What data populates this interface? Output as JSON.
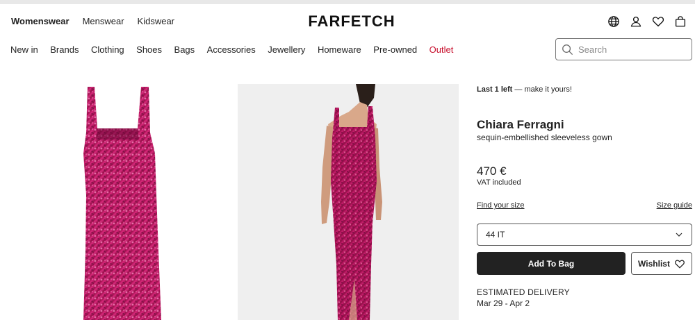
{
  "header": {
    "gender_nav": [
      "Womenswear",
      "Menswear",
      "Kidswear"
    ],
    "active_gender": "Womenswear",
    "logo": "FARFETCH",
    "icons": [
      "globe-icon",
      "account-icon",
      "wishlist-heart-icon",
      "shopping-bag-icon"
    ]
  },
  "categories": [
    "New in",
    "Brands",
    "Clothing",
    "Shoes",
    "Bags",
    "Accessories",
    "Jewellery",
    "Homeware",
    "Pre-owned",
    "Outlet"
  ],
  "colors": {
    "outlet": "#c8102e",
    "primary_button": "#222222",
    "dress": "#b0125a"
  },
  "search": {
    "placeholder": "Search",
    "icon": "search-icon"
  },
  "product": {
    "stock_bold": "Last 1 left",
    "stock_rest": " — make it yours!",
    "brand": "Chiara Ferragni",
    "name": "sequin-embellished sleeveless gown",
    "price": "470 €",
    "vat": "VAT included",
    "find_size": "Find your size",
    "size_guide": "Size guide",
    "selected_size": "44 IT",
    "add_to_bag": "Add To Bag",
    "wishlist": "Wishlist",
    "delivery_label": "ESTIMATED DELIVERY",
    "delivery_dates": "Mar 29 - Apr 2"
  }
}
